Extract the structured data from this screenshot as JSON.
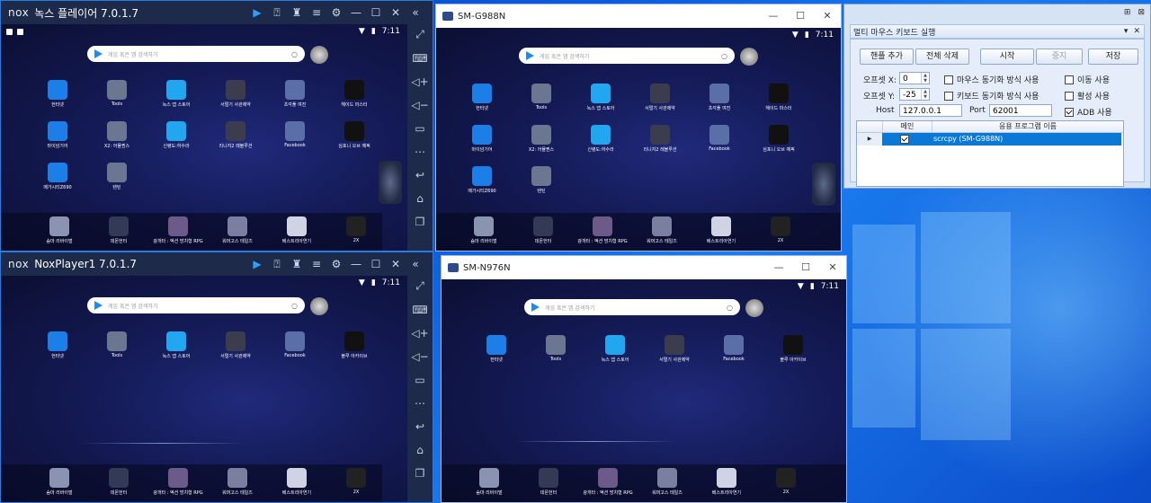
{
  "nox1": {
    "title": "녹스 플레이어 7.0.1.7",
    "logo": "nox",
    "time": "7:11",
    "search_placeholder": "게임 혹은 앱 검색하기"
  },
  "nox2": {
    "title": "NoxPlayer1 7.0.1.7",
    "logo": "nox",
    "time": "7:11",
    "search_placeholder": "게임 혹은 앱 검색하기"
  },
  "scrcpy1": {
    "title": "SM-G988N",
    "time": "7:11",
    "search_placeholder": "게임 혹은 앱 검색하기"
  },
  "scrcpy2": {
    "title": "SM-N976N",
    "time": "7:11",
    "search_placeholder": "게임 혹은 앱 검색하기"
  },
  "apps_full": [
    [
      "헌터넷",
      "Tools",
      "녹스 앱 스토어",
      "서멀기 사관제약",
      "초각풀 여진",
      "헤이드 마스터"
    ],
    [
      "마이넘기어",
      "X2: 어뮬퀀스",
      "신령도:하수라",
      "리니지2 레볼루션",
      "Facebook",
      "심포니 오브 예픽"
    ],
    [
      "메가시티Z690",
      "텐틴"
    ]
  ],
  "apps_small": [
    "헌터넷",
    "Tools",
    "녹스 앱 스토어",
    "서멀기 사관제약",
    "Facebook",
    "블루 아카이브"
  ],
  "dock_apps": [
    "숨마 리바이벌",
    "데몬헌터",
    "광개타 : 액션 방치형 RPG",
    "워머고스 테일즈",
    "베스트리아연기",
    "2X"
  ],
  "dialog": {
    "title": "멀티 마우스 키보드 실행",
    "btn_add": "핸플 추가",
    "btn_delete_all": "전체 삭제",
    "btn_start": "시작",
    "btn_stop": "중지",
    "btn_save": "저장",
    "offset_x_label": "오프셋 X:",
    "offset_x_value": "0",
    "offset_y_label": "오프셋 Y:",
    "offset_y_value": "-25",
    "host_label": "Host",
    "host_value": "127.0.0.1",
    "port_label": "Port",
    "port_value": "62001",
    "chk_mouse_sync": "마우스 동기화 방식 사용",
    "chk_keyboard_sync": "키보드 동기화 방식 사용",
    "chk_move": "이동 사용",
    "chk_active": "활성 사용",
    "chk_adb": "ADB 사용",
    "col_main": "메인",
    "col_app": "응용 프로그램 이름",
    "row_app": "scrcpy (SM-G988N)"
  },
  "colors": {
    "nox_bg": "#131a4a",
    "accent": "#1a8cf0",
    "selection": "#0a78d4"
  }
}
